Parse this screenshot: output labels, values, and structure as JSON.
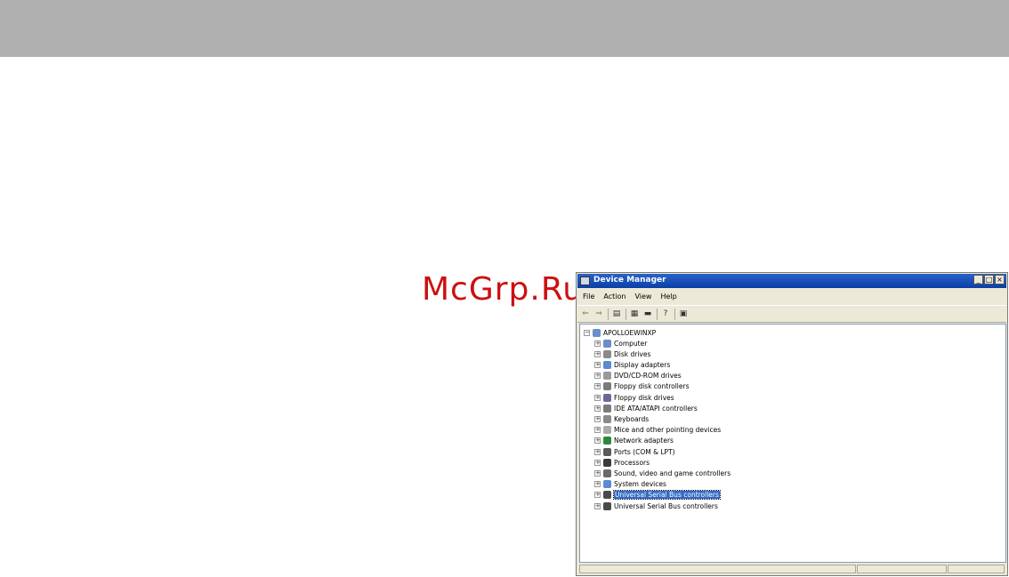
{
  "watermark": "McGrp.Ru",
  "window": {
    "title": "Device Manager",
    "caption_buttons": {
      "minimize": "_",
      "maximize": "□",
      "close": "×"
    }
  },
  "menu": [
    "File",
    "Action",
    "View",
    "Help"
  ],
  "toolbar": [
    {
      "name": "back-icon",
      "glyph": "⇐"
    },
    {
      "name": "forward-icon",
      "glyph": "⇒"
    },
    {
      "name": "show-hide-tree-icon",
      "glyph": "▤"
    },
    {
      "name": "properties-icon",
      "glyph": "▦"
    },
    {
      "name": "print-icon",
      "glyph": "▬"
    },
    {
      "name": "help-icon",
      "glyph": "?"
    },
    {
      "name": "scan-hardware-icon",
      "glyph": "▣"
    }
  ],
  "tree": {
    "root": "APOLLOEWINXP",
    "items": [
      {
        "label": "Computer",
        "icon": "computer-icon",
        "color": "#6a8ec8"
      },
      {
        "label": "Disk drives",
        "icon": "disk-drive-icon",
        "color": "#8a8a8a"
      },
      {
        "label": "Display adapters",
        "icon": "display-adapter-icon",
        "color": "#5a8ad0"
      },
      {
        "label": "DVD/CD-ROM drives",
        "icon": "cd-rom-icon",
        "color": "#9a9a9a"
      },
      {
        "label": "Floppy disk controllers",
        "icon": "floppy-controller-icon",
        "color": "#7a7a7a"
      },
      {
        "label": "Floppy disk drives",
        "icon": "floppy-drive-icon",
        "color": "#6a6a9a"
      },
      {
        "label": "IDE ATA/ATAPI controllers",
        "icon": "ide-controller-icon",
        "color": "#7a7a7a"
      },
      {
        "label": "Keyboards",
        "icon": "keyboard-icon",
        "color": "#8a8a8a"
      },
      {
        "label": "Mice and other pointing devices",
        "icon": "mouse-icon",
        "color": "#aaaaaa"
      },
      {
        "label": "Network adapters",
        "icon": "network-adapter-icon",
        "color": "#2a8a3a"
      },
      {
        "label": "Ports (COM & LPT)",
        "icon": "port-icon",
        "color": "#5a5a5a"
      },
      {
        "label": "Processors",
        "icon": "processor-icon",
        "color": "#3a3a3a"
      },
      {
        "label": "Sound, video and game controllers",
        "icon": "sound-icon",
        "color": "#6a6a6a"
      },
      {
        "label": "System devices",
        "icon": "system-device-icon",
        "color": "#5a8ad0"
      },
      {
        "label": "Universal Serial Bus controllers",
        "icon": "usb-icon",
        "color": "#4a4a4a",
        "selected": true
      },
      {
        "label": "Universal Serial Bus controllers",
        "icon": "usb-icon",
        "color": "#4a4a4a"
      }
    ]
  },
  "colors": {
    "accent": "#316ac5",
    "titlebar": "#0a3ea8",
    "watermark": "#cc1010"
  }
}
